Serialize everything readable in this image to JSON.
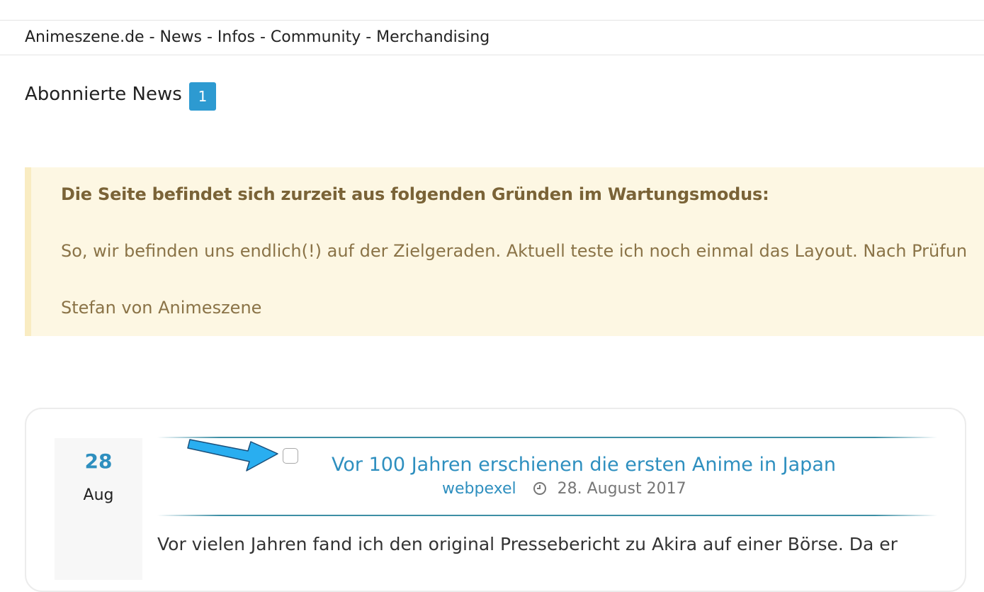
{
  "header": {
    "site_title": "Animeszene.de - News - Infos - Community - Merchandising"
  },
  "page": {
    "heading": "Abonnierte News",
    "badge_count": "1"
  },
  "notice": {
    "title": "Die Seite befindet sich zurzeit aus folgenden Gründen im Wartungsmodus:",
    "text": "So, wir befinden uns endlich(!) auf der Zielgeraden. Aktuell teste ich noch einmal das Layout. Nach Prüfun",
    "signature": "Stefan von Animeszene"
  },
  "article": {
    "day": "28",
    "month": "Aug",
    "title": "Vor 100 Jahren erschienen die ersten Anime in Japan",
    "author": "webpexel",
    "date": "28. August 2017",
    "excerpt": "Vor vielen Jahren fand ich den original Pressebericht zu Akira auf einer Börse. Da er",
    "checked": false
  },
  "icons": {
    "clock": "clock-icon",
    "arrow": "arrow-annotation-icon"
  },
  "colors": {
    "accent": "#2e8fbf",
    "badge": "#2d9ad1",
    "notice_bg": "#fdf7e3",
    "notice_text": "#8a7347",
    "arrow": "#29aef0"
  }
}
